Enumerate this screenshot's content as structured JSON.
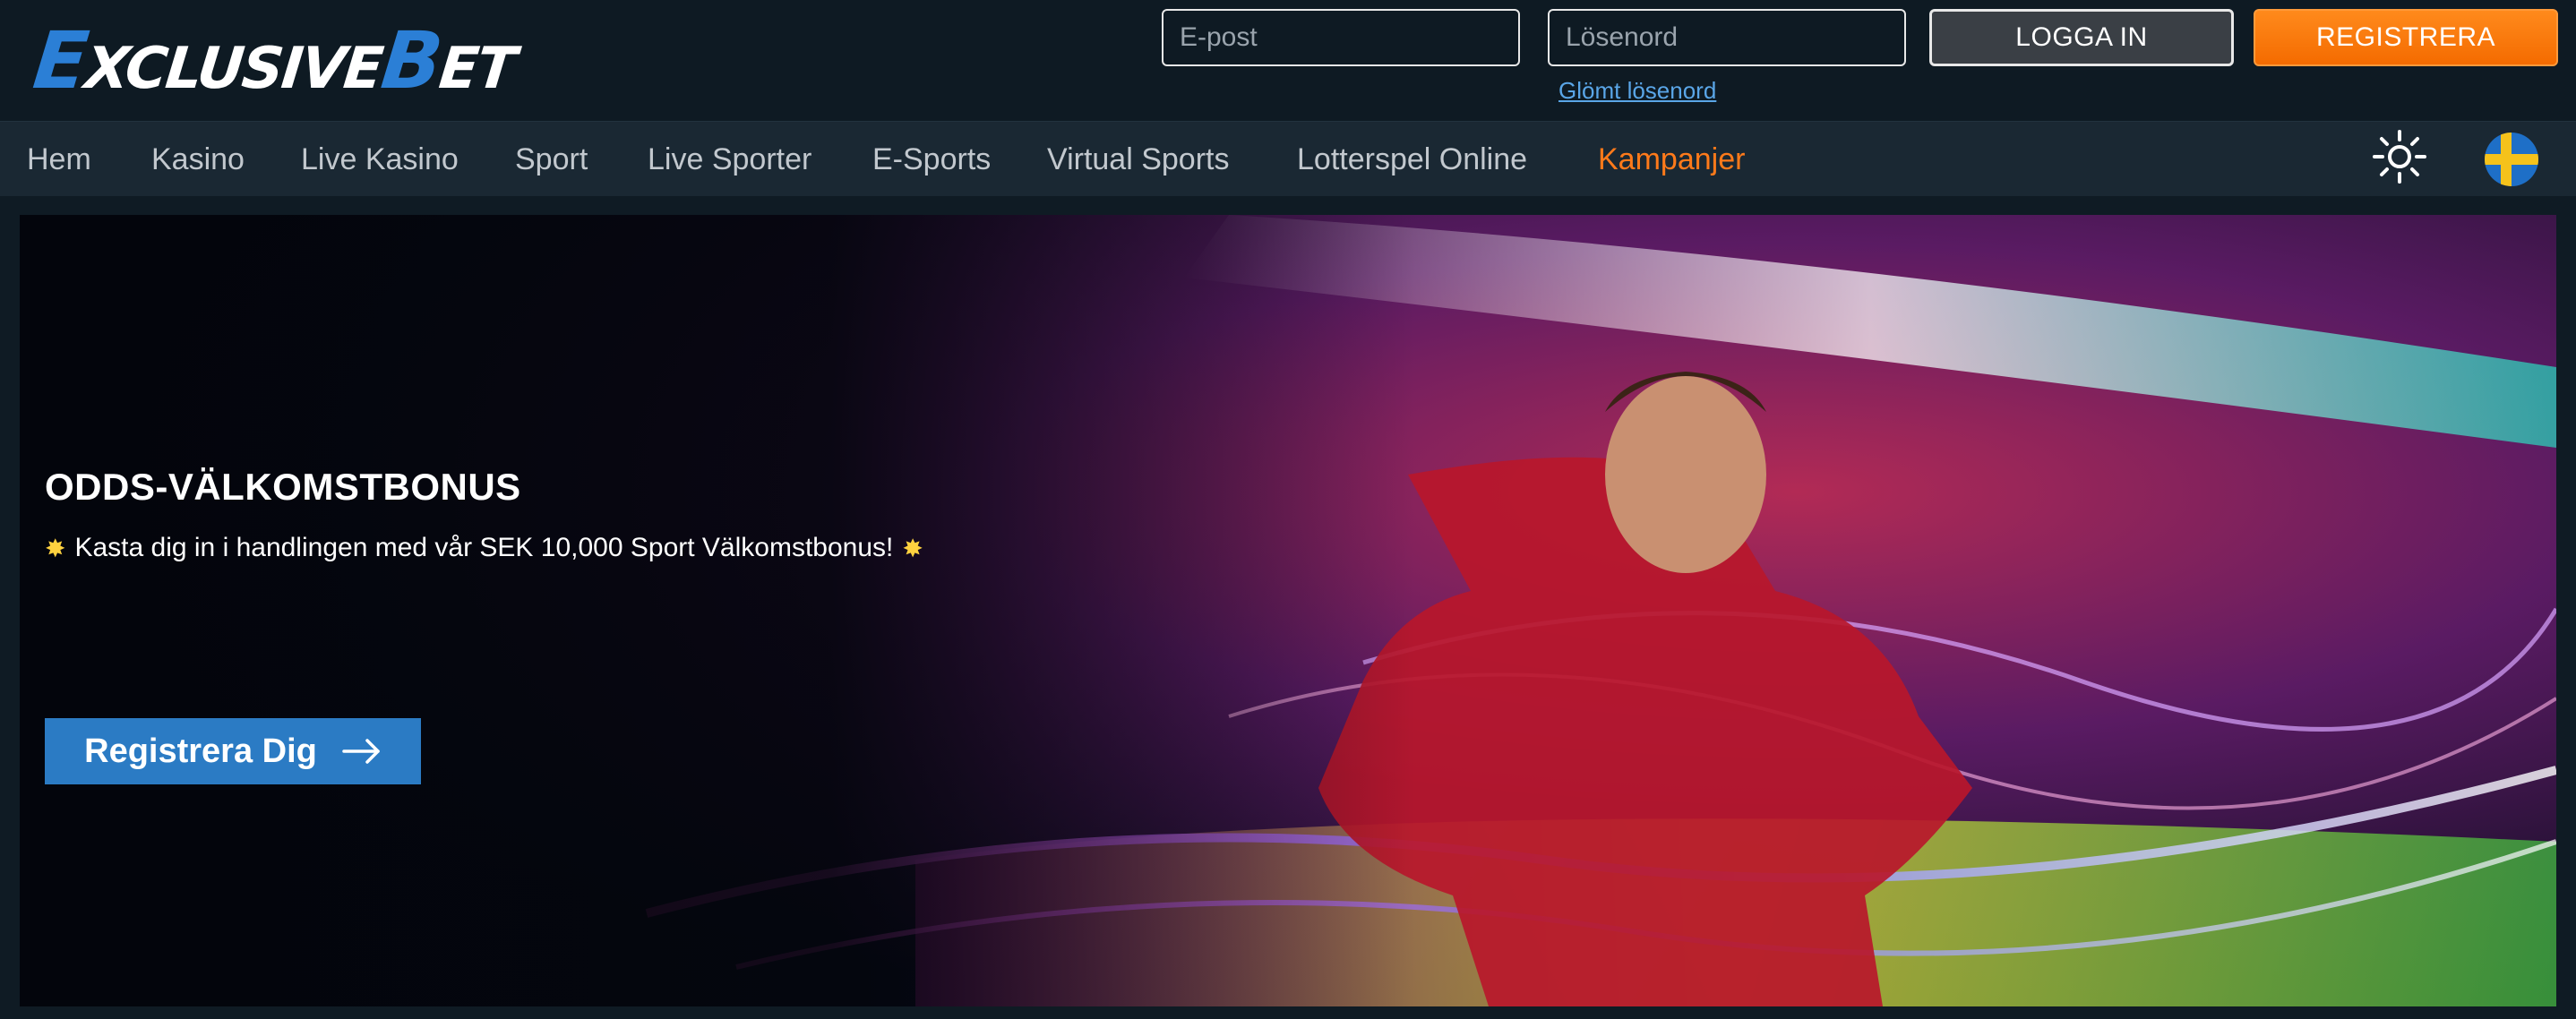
{
  "brand": {
    "logo_big_e": "E",
    "logo_mid": "XCLUSIVE",
    "logo_big_b": "B",
    "logo_tail": "ET"
  },
  "auth": {
    "email_placeholder": "E-post",
    "password_placeholder": "Lösenord",
    "login_label": "LOGGA IN",
    "register_label": "REGISTRERA",
    "forgot_label": "Glömt lösenord"
  },
  "nav": {
    "items": [
      {
        "label": "Hem"
      },
      {
        "label": "Kasino"
      },
      {
        "label": "Live Kasino"
      },
      {
        "label": "Sport"
      },
      {
        "label": "Live Sporter"
      },
      {
        "label": "E-Sports"
      },
      {
        "label": "Virtual Sports"
      },
      {
        "label": "Lotterspel Online"
      },
      {
        "label": "Kampanjer"
      }
    ],
    "active_item": "Kampanjer"
  },
  "icons": {
    "theme": "sun-icon",
    "language": "sweden-flag-icon",
    "cta_arrow": "arrow-right-icon"
  },
  "hero": {
    "title": "ODDS-VÄLKOMSTBONUS",
    "subtitle": "Kasta dig in i handlingen med vår SEK 10,000 Sport Välkomstbonus!",
    "cta_label": "Registrera Dig"
  },
  "colors": {
    "accent_orange": "#ff7a1a",
    "brand_blue": "#2b7bc4",
    "background": "#0e1a23",
    "nav_background": "#1a2833"
  }
}
